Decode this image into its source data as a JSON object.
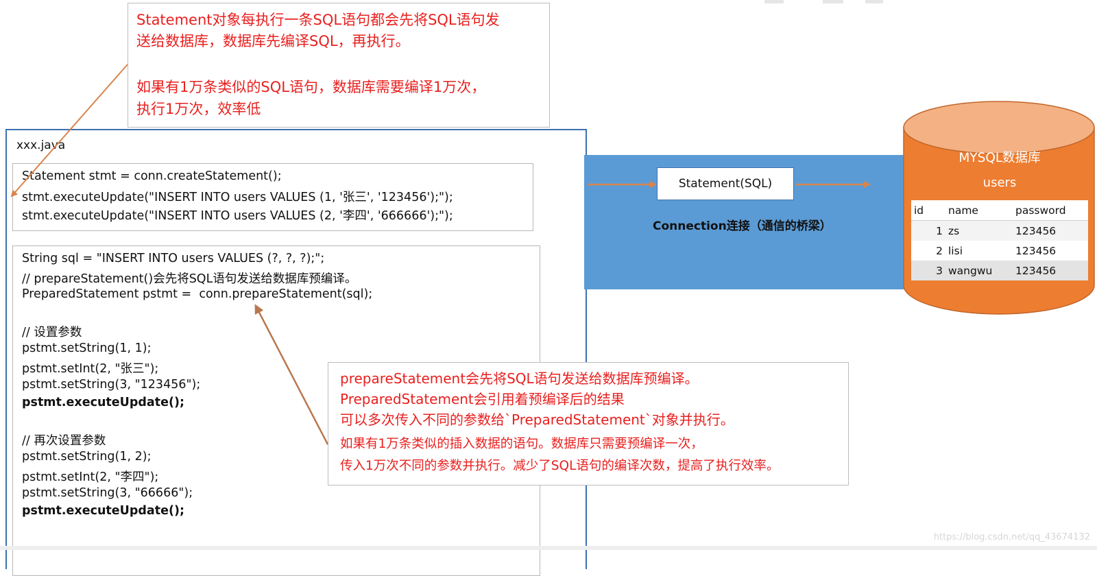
{
  "note_top": {
    "line1": "Statement对象每执行一条SQL语句都会先将SQL语句发",
    "line2": "送给数据库，数据库先编译SQL，再执行。",
    "line3": "如果有1万条类似的SQL语句，数据库需要编译1万次，",
    "line4": "执行1万次，效率低"
  },
  "java_file": {
    "title": "xxx.java",
    "statement_code": [
      "Statement stmt = conn.createStatement();",
      "stmt.executeUpdate(\"INSERT INTO users VALUES (1, '张三', '123456');\");",
      "stmt.executeUpdate(\"INSERT INTO users VALUES (2, '李四', '666666');\");"
    ],
    "prepared_code": [
      "String sql = \"INSERT INTO users VALUES (?, ?, ?);\";",
      "// prepareStatement()会先将SQL语句发送给数据库预编译。",
      "PreparedStatement pstmt =  conn.prepareStatement(sql);",
      "// 设置参数",
      "pstmt.setString(1, 1);",
      "pstmt.setInt(2, \"张三\");",
      "pstmt.setString(3, \"123456\");",
      "pstmt.executeUpdate();",
      "// 再次设置参数",
      "pstmt.setString(1, 2);",
      "pstmt.setInt(2, \"李四\");",
      "pstmt.setString(3, \"66666\");",
      "pstmt.executeUpdate();"
    ]
  },
  "connection": {
    "statement_label": "Statement(SQL)",
    "label": "Connection连接（通信的桥梁）"
  },
  "database": {
    "title": "MYSQL数据库",
    "table_name": "users",
    "columns": [
      "id",
      "name",
      "password"
    ],
    "rows": [
      {
        "id": "1",
        "name": "zs",
        "password": "123456"
      },
      {
        "id": "2",
        "name": "lisi",
        "password": "123456"
      },
      {
        "id": "3",
        "name": "wangwu",
        "password": "123456"
      }
    ]
  },
  "note_bottom": {
    "line1": "prepareStatement会先将SQL语句发送给数据库预编译。",
    "line2": "PreparedStatement会引用着预编译后的结果",
    "line3": "可以多次传入不同的参数给`PreparedStatement`对象并执行。",
    "line4": "如果有1万条类似的插入数据的语句。数据库只需要预编译一次，",
    "line5": "传入1万次不同的参数并执行。减少了SQL语句的编译次数，提高了执行效率。"
  },
  "watermark": "https://blog.csdn.net/qq_43674132",
  "colors": {
    "note_text": "#e8201f",
    "arrow": "#d9844c",
    "band": "#5b9bd5",
    "db_body": "#ed7d31",
    "frame_border": "#3d6fb0"
  }
}
